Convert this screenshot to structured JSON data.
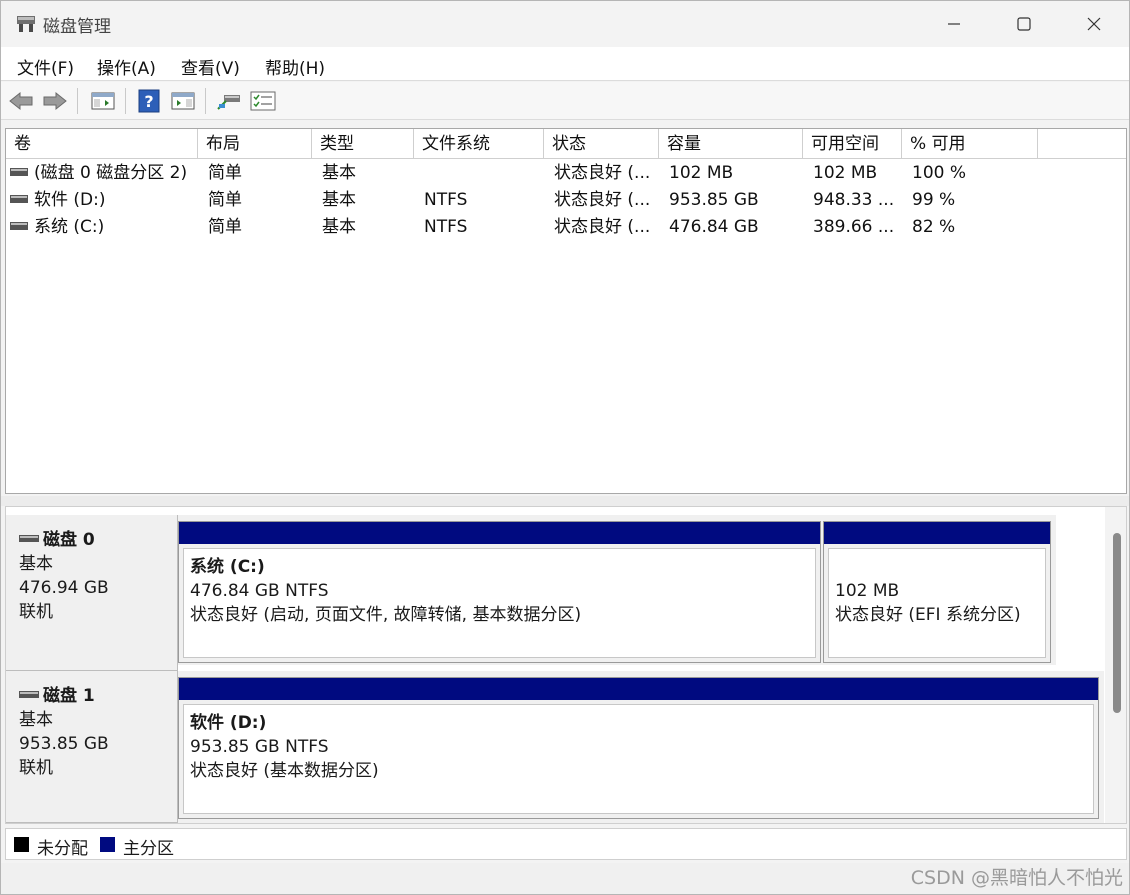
{
  "window": {
    "title": "磁盘管理"
  },
  "menu": [
    {
      "label": "文件(F)"
    },
    {
      "label": "操作(A)"
    },
    {
      "label": "查看(V)"
    },
    {
      "label": "帮助(H)"
    }
  ],
  "toolbar": {
    "icons": [
      "back-arrow-icon",
      "forward-arrow-icon",
      "console-tree-icon",
      "help-icon",
      "action-pane-icon",
      "connect-disk-icon",
      "properties-icon"
    ]
  },
  "columns": [
    "卷",
    "布局",
    "类型",
    "文件系统",
    "状态",
    "容量",
    "可用空间",
    "% 可用"
  ],
  "volumes": [
    {
      "name": "(磁盘 0 磁盘分区 2)",
      "layout": "简单",
      "type": "基本",
      "fs": "",
      "status": "状态良好 (...",
      "capacity": "102 MB",
      "free": "102 MB",
      "pct": "100 %"
    },
    {
      "name": "软件 (D:)",
      "layout": "简单",
      "type": "基本",
      "fs": "NTFS",
      "status": "状态良好 (...",
      "capacity": "953.85 GB",
      "free": "948.33 ...",
      "pct": "99 %"
    },
    {
      "name": "系统 (C:)",
      "layout": "简单",
      "type": "基本",
      "fs": "NTFS",
      "status": "状态良好 (...",
      "capacity": "476.84 GB",
      "free": "389.66 ...",
      "pct": "82 %"
    }
  ],
  "disks": [
    {
      "name": "磁盘 0",
      "type": "基本",
      "size": "476.94 GB",
      "state": "联机",
      "partitions": [
        {
          "name": "系统 (C:)",
          "size": "476.84 GB NTFS",
          "status": "状态良好 (启动, 页面文件, 故障转储, 基本数据分区)"
        },
        {
          "name": "",
          "size": "102 MB",
          "status": "状态良好 (EFI 系统分区)"
        }
      ]
    },
    {
      "name": "磁盘 1",
      "type": "基本",
      "size": "953.85 GB",
      "state": "联机",
      "partitions": [
        {
          "name": "软件 (D:)",
          "size": "953.85 GB NTFS",
          "status": "状态良好 (基本数据分区)"
        }
      ]
    }
  ],
  "legend": [
    {
      "label": "未分配",
      "color": "#000000"
    },
    {
      "label": "主分区",
      "color": "#000a80"
    }
  ],
  "watermark": "CSDN @黑暗怕人不怕光"
}
